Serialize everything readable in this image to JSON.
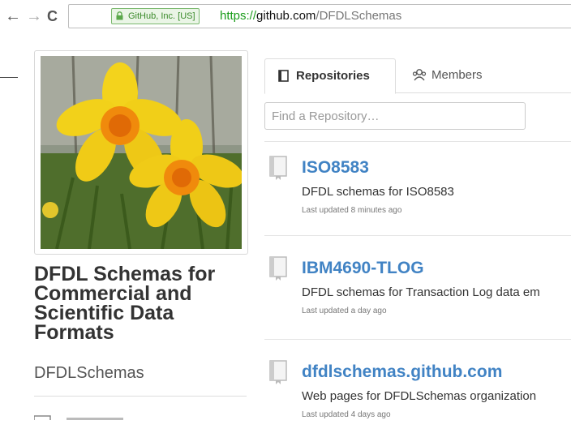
{
  "browser": {
    "ev_label": "GitHub, Inc. [US]",
    "url_scheme": "https://",
    "url_domain": "github.com",
    "url_path": "/DFDLSchemas"
  },
  "org": {
    "name": "DFDL Schemas for Commercial and Scientific Data Formats",
    "login": "DFDLSchemas",
    "avatar_description": "yellow daffodils with orange trumpets"
  },
  "tabs": [
    {
      "label": "Repositories",
      "icon": "repo-icon",
      "selected": true
    },
    {
      "label": "Members",
      "icon": "members-icon",
      "selected": false
    }
  ],
  "search": {
    "placeholder": "Find a Repository…",
    "value": ""
  },
  "repositories": [
    {
      "name": "ISO8583",
      "description": "DFDL schemas for ISO8583",
      "updated": "Last updated 8 minutes ago"
    },
    {
      "name": "IBM4690-TLOG",
      "description": "DFDL schemas for Transaction Log data em",
      "updated": "Last updated a day ago"
    },
    {
      "name": "dfdlschemas.github.com",
      "description": "Web pages for DFDLSchemas organization",
      "updated": "Last updated 4 days ago"
    }
  ],
  "colors": {
    "link": "#4183c4",
    "secure_green": "#1a9c1a"
  }
}
